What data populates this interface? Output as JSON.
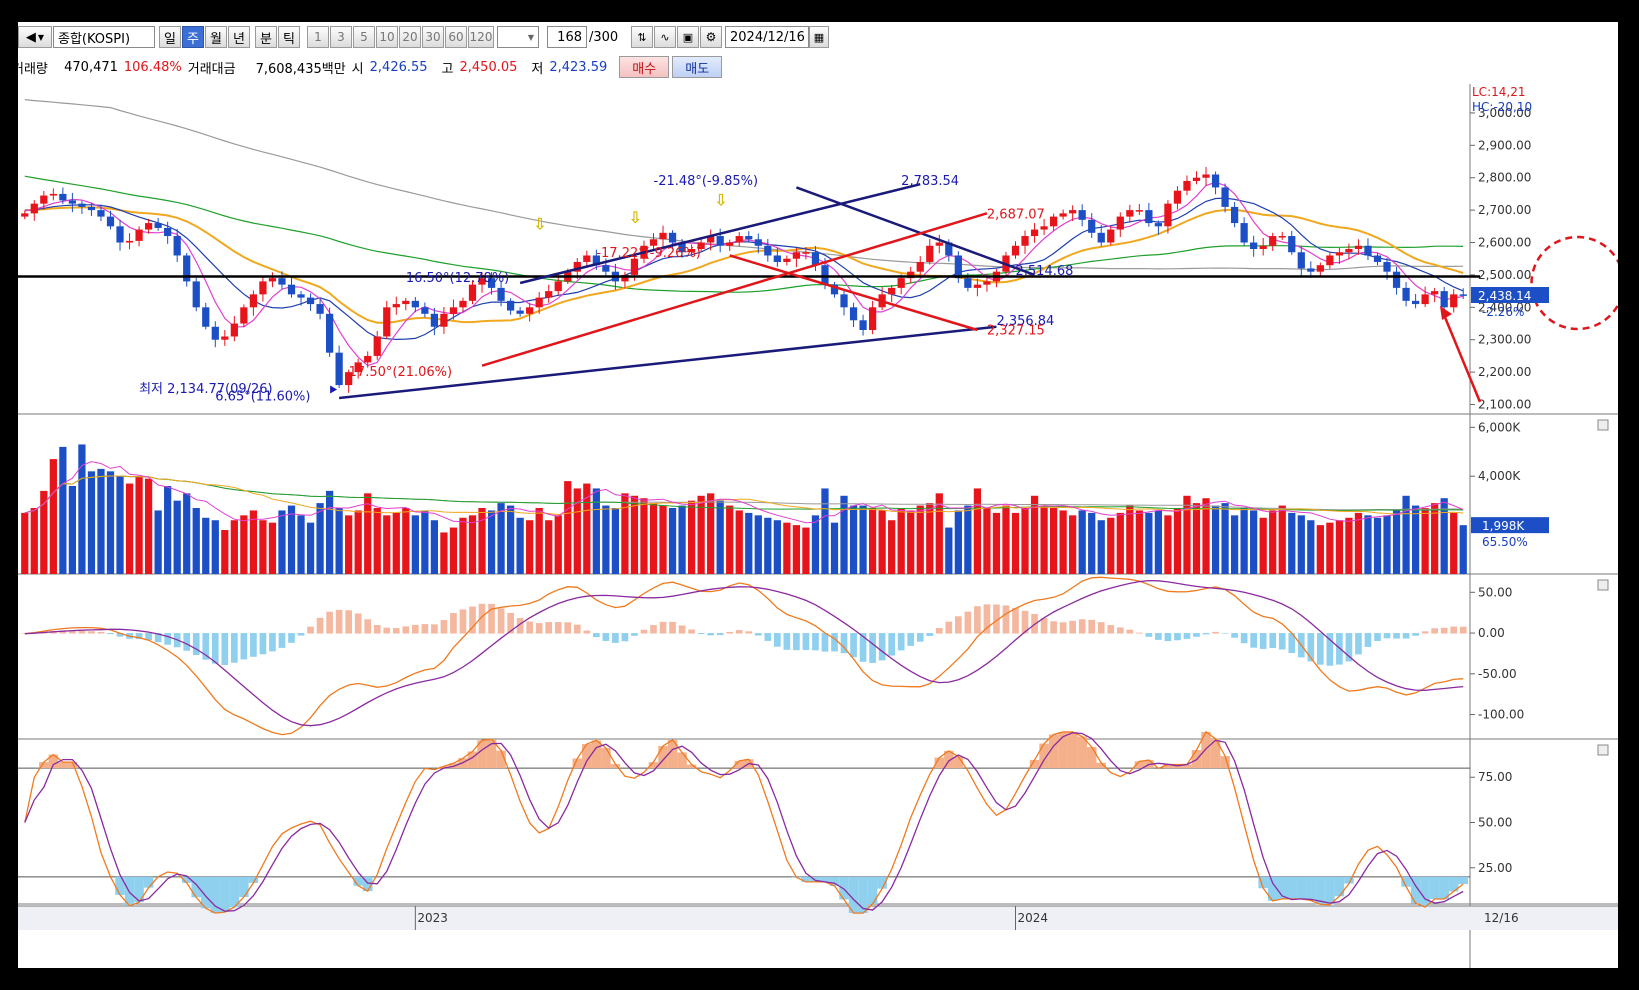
{
  "toolbar": {
    "symbol": "종합(KOSPI)",
    "periods": [
      "일",
      "주",
      "월",
      "년",
      "분",
      "틱"
    ],
    "selected_period": "주",
    "intervals": [
      "1",
      "3",
      "5",
      "10",
      "20",
      "30",
      "60",
      "120"
    ],
    "count_value": "168",
    "count_total": "/300",
    "date": "2024/12/16"
  },
  "infobar": {
    "volume_label": "거래량",
    "volume_value": "470,471",
    "volume_pct": "106.48%",
    "amount_label": "거래대금",
    "amount_value": "7,608,435백만",
    "open_label": "시",
    "open_value": "2,426.55",
    "high_label": "고",
    "high_value": "2,450.05",
    "low_label": "저",
    "low_value": "2,423.59",
    "buy_label": "매수",
    "sell_label": "매도"
  },
  "colors": {
    "up": "#e8141b",
    "down": "#1c4fc6",
    "ma5": "#e33fd0",
    "ma10": "#1f3fae",
    "ma20": "#f0a81e",
    "ma60": "#1fa02c",
    "ma120": "#9a9a9a"
  },
  "chart_data": [
    {
      "type": "candlestick",
      "name": "price",
      "y_ticks": [
        "3,000.00",
        "2,900.00",
        "2,800.00",
        "2,700.00",
        "2,600.00",
        "2,500.00",
        "2,400.00",
        "2,300.00",
        "2,200.00",
        "2,100.00"
      ],
      "ylim": [
        2080,
        3080
      ],
      "legend": [
        "LC:14,21",
        "HC:-20,10"
      ],
      "current_price": "2,438.14",
      "current_change": "-2.26%",
      "horizontal_line": 2495,
      "annotations": [
        {
          "text": "최저 2,134.77(09/26)",
          "color": "#1a1ab0"
        },
        {
          "text": "6.65°(11.60%)",
          "color": "#1a1ab0"
        },
        {
          "text": "17.50°(21.06%)",
          "color": "#e0161b"
        },
        {
          "text": "16.50°(12.78%)",
          "color": "#1a1ab0"
        },
        {
          "text": "-17.22°(-9.26%)",
          "color": "#e0161b"
        },
        {
          "text": "-21.48°(-9.85%)",
          "color": "#1a1ab0"
        },
        {
          "text": "2,783.54",
          "color": "#1a1ab0"
        },
        {
          "text": "2,687.07",
          "color": "#e0161b"
        },
        {
          "text": "2,514.68",
          "color": "#1a1ab0"
        },
        {
          "text": "2,356.84",
          "color": "#1a1ab0"
        },
        {
          "text": "2,327.15",
          "color": "#e0161b"
        }
      ],
      "closes": [
        2690,
        2720,
        2745,
        2750,
        2730,
        2720,
        2710,
        2700,
        2680,
        2650,
        2600,
        2605,
        2640,
        2660,
        2645,
        2620,
        2560,
        2480,
        2400,
        2340,
        2300,
        2310,
        2350,
        2400,
        2440,
        2480,
        2490,
        2470,
        2440,
        2430,
        2410,
        2380,
        2260,
        2160,
        2200,
        2230,
        2250,
        2310,
        2400,
        2410,
        2420,
        2400,
        2380,
        2340,
        2380,
        2400,
        2420,
        2470,
        2490,
        2460,
        2420,
        2390,
        2380,
        2400,
        2430,
        2450,
        2480,
        2510,
        2540,
        2560,
        2530,
        2510,
        2480,
        2500,
        2550,
        2590,
        2610,
        2630,
        2600,
        2570,
        2580,
        2600,
        2620,
        2590,
        2600,
        2620,
        2610,
        2590,
        2560,
        2540,
        2550,
        2570,
        2570,
        2530,
        2470,
        2440,
        2400,
        2360,
        2330,
        2400,
        2440,
        2460,
        2490,
        2510,
        2540,
        2590,
        2600,
        2560,
        2490,
        2460,
        2470,
        2480,
        2510,
        2560,
        2590,
        2620,
        2640,
        2650,
        2680,
        2690,
        2700,
        2670,
        2630,
        2600,
        2640,
        2680,
        2700,
        2700,
        2660,
        2650,
        2720,
        2760,
        2790,
        2800,
        2810,
        2770,
        2710,
        2660,
        2600,
        2580,
        2590,
        2620,
        2620,
        2570,
        2520,
        2510,
        2530,
        2560,
        2570,
        2580,
        2590,
        2560,
        2540,
        2510,
        2460,
        2420,
        2410,
        2440,
        2450,
        2400,
        2440,
        2438
      ]
    },
    {
      "type": "bar",
      "name": "volume",
      "y_ticks": [
        "6,000K",
        "4,000K"
      ],
      "ylim": [
        0,
        6300
      ],
      "current_value": "1,998K",
      "current_pct": "65.50%",
      "values": [
        2500,
        2700,
        3400,
        4700,
        5200,
        3600,
        5300,
        4200,
        4300,
        4200,
        4000,
        3700,
        4000,
        3900,
        2600,
        3600,
        3000,
        3300,
        2700,
        2300,
        2200,
        1800,
        2200,
        2400,
        2600,
        2200,
        2100,
        2600,
        2800,
        2400,
        2100,
        2900,
        3400,
        2700,
        2400,
        2600,
        3300,
        2700,
        2400,
        2500,
        2700,
        2400,
        2600,
        2200,
        1700,
        1900,
        2300,
        2400,
        2700,
        2600,
        2900,
        2800,
        2300,
        2200,
        2700,
        2200,
        2400,
        3800,
        3500,
        3700,
        3500,
        2800,
        2700,
        3300,
        3200,
        3100,
        2900,
        2800,
        2700,
        2800,
        3000,
        3200,
        3300,
        3000,
        2800,
        2600,
        2500,
        2400,
        2300,
        2200,
        2100,
        2000,
        1900,
        2400,
        3500,
        2100,
        3200,
        2800,
        2800,
        2700,
        2600,
        2200,
        2700,
        2600,
        2800,
        2900,
        3300,
        1900,
        2600,
        2800,
        3500,
        2700,
        2500,
        2800,
        2500,
        2700,
        3200,
        2800,
        2700,
        2600,
        2400,
        2600,
        2500,
        2200,
        2300,
        2500,
        2800,
        2600,
        2500,
        2600,
        2400,
        2700,
        3200,
        2900,
        3100,
        2800,
        2900,
        2400,
        2700,
        2600,
        2300,
        2600,
        2800,
        2500,
        2400,
        2200,
        2000,
        2100,
        2200,
        2300,
        2500,
        2400,
        2300,
        2400,
        2600,
        3200,
        2800,
        2700,
        2900,
        3100,
        2500,
        1998
      ]
    },
    {
      "type": "line",
      "name": "macd",
      "y_ticks": [
        "50.00",
        "0.00",
        "-50.00",
        "-100.00"
      ],
      "ylim": [
        -130,
        70
      ]
    },
    {
      "type": "line",
      "name": "stochastic",
      "y_ticks": [
        "75.00",
        "50.00",
        "25.00"
      ],
      "ylim": [
        5,
        95
      ],
      "levels": [
        80,
        20
      ]
    }
  ],
  "xaxis": {
    "labels": [
      "2023",
      "2024"
    ],
    "end_label": "12/16"
  }
}
